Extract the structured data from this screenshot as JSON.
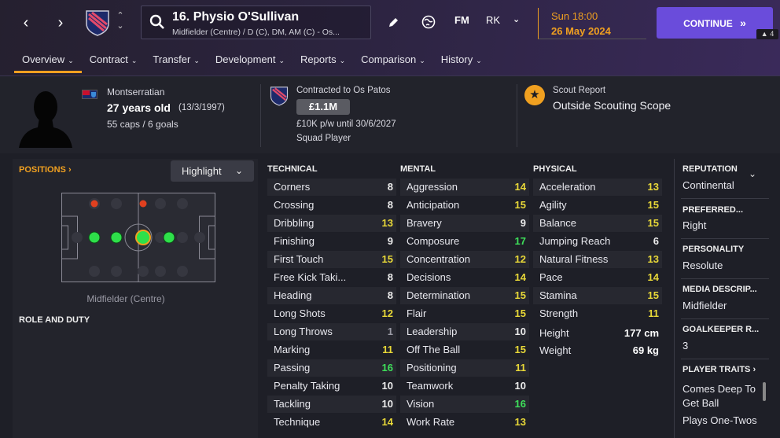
{
  "header": {
    "player_name": "16. Physio O'Sullivan",
    "player_positions": "Midfielder (Centre) / D (C), DM, AM (C) - Os...",
    "fm_label": "FM",
    "rk_label": "RK",
    "date_day": "Sun 18:00",
    "date_full": "26 May 2024",
    "continue_label": "CONTINUE",
    "badge_count": "4",
    "icons": [
      "back-arrow-icon",
      "forward-arrow-icon",
      "club-crest-icon",
      "search-icon",
      "edit-pencil-icon",
      "globe-icon",
      "chevron-down-icon"
    ]
  },
  "tabs": [
    {
      "label": "Overview"
    },
    {
      "label": "Contract"
    },
    {
      "label": "Transfer"
    },
    {
      "label": "Development"
    },
    {
      "label": "Reports"
    },
    {
      "label": "Comparison"
    },
    {
      "label": "History"
    }
  ],
  "profile": {
    "nationality": "Montserratian",
    "age_label": "27 years old",
    "dob": "(13/3/1997)",
    "caps": "55 caps / 6 goals",
    "contract_title": "Contracted to Os Patos",
    "value": "£1.1M",
    "wage": "£10K p/w until 30/6/2027",
    "squad_status": "Squad Player",
    "scout_title": "Scout Report",
    "scout_value": "Outside Scouting Scope"
  },
  "positions": {
    "link_label": "POSITIONS",
    "highlight_label": "Highlight",
    "position_label": "Midfielder (Centre)",
    "role_duty_label": "ROLE AND DUTY"
  },
  "attributes": {
    "technical_title": "TECHNICAL",
    "mental_title": "MENTAL",
    "physical_title": "PHYSICAL",
    "technical": [
      {
        "name": "Corners",
        "value": "8",
        "color": "#ececec"
      },
      {
        "name": "Crossing",
        "value": "8",
        "color": "#ececec"
      },
      {
        "name": "Dribbling",
        "value": "13",
        "color": "#e8d838"
      },
      {
        "name": "Finishing",
        "value": "9",
        "color": "#ececec"
      },
      {
        "name": "First Touch",
        "value": "15",
        "color": "#e8d838"
      },
      {
        "name": "Free Kick Taki...",
        "value": "8",
        "color": "#ececec"
      },
      {
        "name": "Heading",
        "value": "8",
        "color": "#ececec"
      },
      {
        "name": "Long Shots",
        "value": "12",
        "color": "#e8d838"
      },
      {
        "name": "Long Throws",
        "value": "1",
        "color": "#9a9aa5"
      },
      {
        "name": "Marking",
        "value": "11",
        "color": "#e8d838"
      },
      {
        "name": "Passing",
        "value": "16",
        "color": "#3ee05a"
      },
      {
        "name": "Penalty Taking",
        "value": "10",
        "color": "#ececec"
      },
      {
        "name": "Tackling",
        "value": "10",
        "color": "#ececec"
      },
      {
        "name": "Technique",
        "value": "14",
        "color": "#e8d838"
      }
    ],
    "mental": [
      {
        "name": "Aggression",
        "value": "14",
        "color": "#e8d838"
      },
      {
        "name": "Anticipation",
        "value": "15",
        "color": "#e8d838"
      },
      {
        "name": "Bravery",
        "value": "9",
        "color": "#ececec"
      },
      {
        "name": "Composure",
        "value": "17",
        "color": "#3ee05a"
      },
      {
        "name": "Concentration",
        "value": "12",
        "color": "#e8d838"
      },
      {
        "name": "Decisions",
        "value": "14",
        "color": "#e8d838"
      },
      {
        "name": "Determination",
        "value": "15",
        "color": "#e8d838"
      },
      {
        "name": "Flair",
        "value": "15",
        "color": "#e8d838"
      },
      {
        "name": "Leadership",
        "value": "10",
        "color": "#ececec"
      },
      {
        "name": "Off The Ball",
        "value": "15",
        "color": "#e8d838"
      },
      {
        "name": "Positioning",
        "value": "11",
        "color": "#e8d838"
      },
      {
        "name": "Teamwork",
        "value": "10",
        "color": "#ececec"
      },
      {
        "name": "Vision",
        "value": "16",
        "color": "#3ee05a"
      },
      {
        "name": "Work Rate",
        "value": "13",
        "color": "#e8d838"
      }
    ],
    "physical": [
      {
        "name": "Acceleration",
        "value": "13",
        "color": "#e8d838"
      },
      {
        "name": "Agility",
        "value": "15",
        "color": "#e8d838"
      },
      {
        "name": "Balance",
        "value": "15",
        "color": "#e8d838"
      },
      {
        "name": "Jumping Reach",
        "value": "6",
        "color": "#ececec"
      },
      {
        "name": "Natural Fitness",
        "value": "13",
        "color": "#e8d838"
      },
      {
        "name": "Pace",
        "value": "14",
        "color": "#e8d838"
      },
      {
        "name": "Stamina",
        "value": "15",
        "color": "#e8d838"
      },
      {
        "name": "Strength",
        "value": "11",
        "color": "#e8d838"
      }
    ],
    "height_label": "Height",
    "height_value": "177 cm",
    "weight_label": "Weight",
    "weight_value": "69 kg"
  },
  "side": {
    "reputation_title": "REPUTATION",
    "reputation_value": "Continental",
    "preferred_title": "PREFERRED...",
    "preferred_value": "Right",
    "personality_title": "PERSONALITY",
    "personality_value": "Resolute",
    "media_title": "MEDIA DESCRIP...",
    "media_value": "Midfielder",
    "gk_title": "GOALKEEPER R...",
    "gk_value": "3",
    "traits_title": "PLAYER TRAITS",
    "trait_1a": "Comes Deep To",
    "trait_1b": "Get Ball",
    "trait_2": "Plays One-Twos"
  }
}
